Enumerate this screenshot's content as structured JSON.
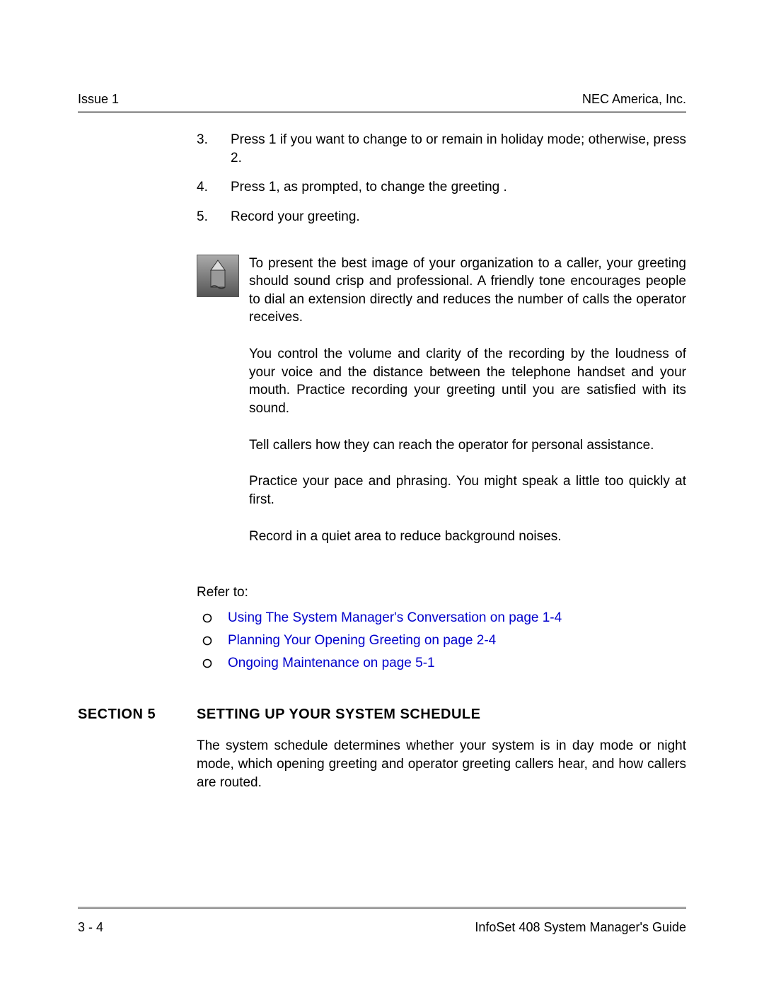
{
  "header": {
    "left": "Issue 1",
    "right": "NEC America, Inc."
  },
  "steps": [
    {
      "num": "3.",
      "text": "Press 1 if you want to change to or remain in holiday mode; otherwise, press 2."
    },
    {
      "num": "4.",
      "text": "Press 1, as prompted, to change the greeting ."
    },
    {
      "num": "5.",
      "text": "Record your greeting."
    }
  ],
  "tip": {
    "paragraphs": [
      "To present the best image of your organization to a caller, your greeting should sound crisp and professional. A friendly tone encourages people to dial an extension directly and reduces the number of calls the operator receives.",
      "You control the volume and clarity of the recording by the loudness of your voice and the distance between the telephone handset and your mouth. Practice recording your greeting until you are satisfied with its sound.",
      "Tell callers how they can reach the operator for personal assistance.",
      "Practice your pace and phrasing. You might speak a little too quickly at first.",
      "Record in a quiet area to reduce background noises."
    ]
  },
  "refer": {
    "label": "Refer to:",
    "links": [
      "Using The System Manager's Conversation on page 1-4",
      "Planning Your Opening Greeting on page 2-4",
      "Ongoing Maintenance on page 5-1"
    ]
  },
  "section": {
    "label": "SECTION 5",
    "title": "SETTING UP YOUR SYSTEM SCHEDULE",
    "body": "The system schedule determines whether your system is in day mode or night mode, which opening greeting and operator greeting callers hear, and how callers are routed."
  },
  "footer": {
    "left": "3 - 4",
    "right": "InfoSet 408 System Manager's Guide"
  }
}
